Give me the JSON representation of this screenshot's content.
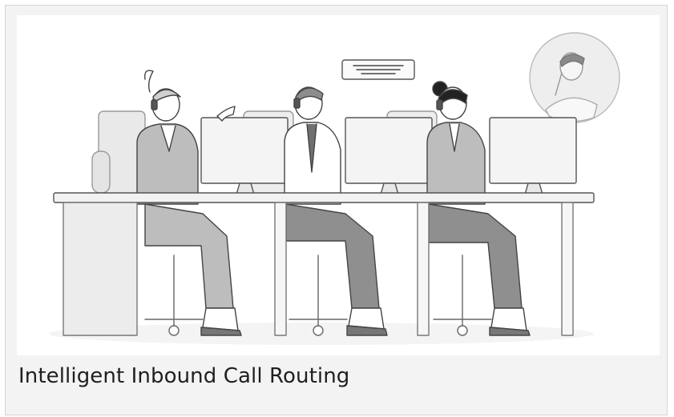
{
  "card": {
    "caption": "Intelligent Inbound Call Routing",
    "illustration": "call-center-agents-illustration"
  }
}
